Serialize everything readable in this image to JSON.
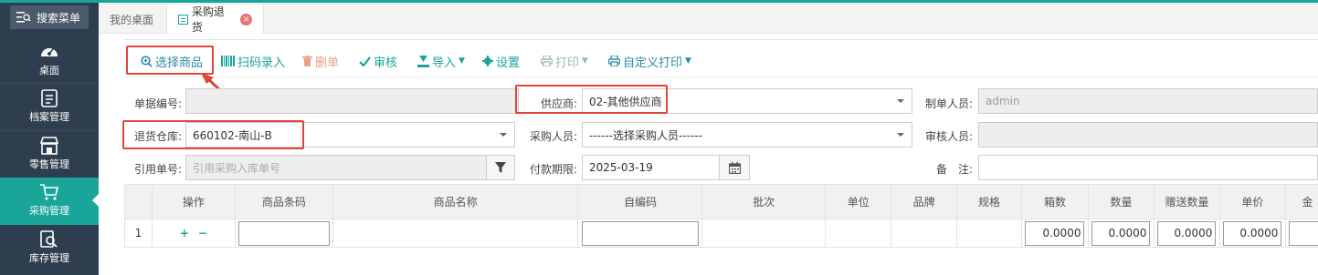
{
  "sidebar": {
    "search_label": "搜索菜单",
    "items": [
      {
        "label": "桌面",
        "icon": "dashboard-icon"
      },
      {
        "label": "档案管理",
        "icon": "archive-icon"
      },
      {
        "label": "零售管理",
        "icon": "store-icon"
      },
      {
        "label": "采购管理",
        "icon": "cart-icon"
      },
      {
        "label": "库存管理",
        "icon": "inventory-icon"
      }
    ],
    "active_index": 3,
    "accent": "#1aa59a",
    "bg": "#2f3e4e"
  },
  "tabs": [
    {
      "label": "我的桌面"
    },
    {
      "label": "采购退货"
    }
  ],
  "toolbar": {
    "select_goods": "选择商品",
    "scan_entry": "扫码录入",
    "delete": "删单",
    "audit": "审核",
    "import": "导入",
    "settings": "设置",
    "print": "打印",
    "custom_print": "自定义打印"
  },
  "form": {
    "doc_no_label": "单据编号:",
    "doc_no_value": "",
    "supplier_label": "供应商:",
    "supplier_value": "02-其他供应商",
    "creator_label": "制单人员:",
    "creator_value": "admin",
    "warehouse_label": "退货仓库:",
    "warehouse_value": "660102-南山-B",
    "buyer_label": "采购人员:",
    "buyer_value": "------选择采购人员------",
    "auditor_label": "审核人员:",
    "auditor_value": "",
    "ref_label": "引用单号:",
    "ref_placeholder": "引用采购入库单号",
    "due_label": "付款期限:",
    "due_value": "2025-03-19",
    "remark_label": "备　注:",
    "remark_value": ""
  },
  "grid": {
    "headers": [
      "",
      "操作",
      "商品条码",
      "商品名称",
      "自编码",
      "批次",
      "单位",
      "品牌",
      "规格",
      "箱数",
      "数量",
      "赠送数量",
      "单价",
      "金"
    ],
    "rows": [
      {
        "index": "1",
        "box_qty": "0.0000",
        "qty": "0.0000",
        "gift_qty": "0.0000",
        "price": "0.0000"
      }
    ]
  }
}
